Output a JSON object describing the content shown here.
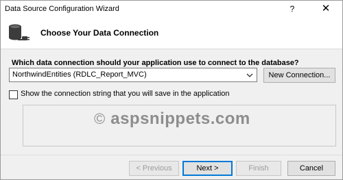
{
  "window": {
    "title": "Data Source Configuration Wizard",
    "help_label": "?",
    "close_label": "✕"
  },
  "header": {
    "title": "Choose Your Data Connection",
    "icon": "database-connection-icon"
  },
  "connection": {
    "question": "Which data connection should your application use to connect to the database?",
    "selected": "NorthwindEntities (RDLC_Report_MVC)",
    "new_connection_label": "New Connection..."
  },
  "show_connstring": {
    "label": "Show the connection string that you will save in the application",
    "checked": false
  },
  "watermark": {
    "symbol": "©",
    "text": "aspsnippets.com"
  },
  "footer": {
    "previous_label": "< Previous",
    "next_label": "Next >",
    "finish_label": "Finish",
    "cancel_label": "Cancel"
  },
  "colors": {
    "accent": "#0078d7",
    "disabled_text": "#9c9c9c"
  }
}
